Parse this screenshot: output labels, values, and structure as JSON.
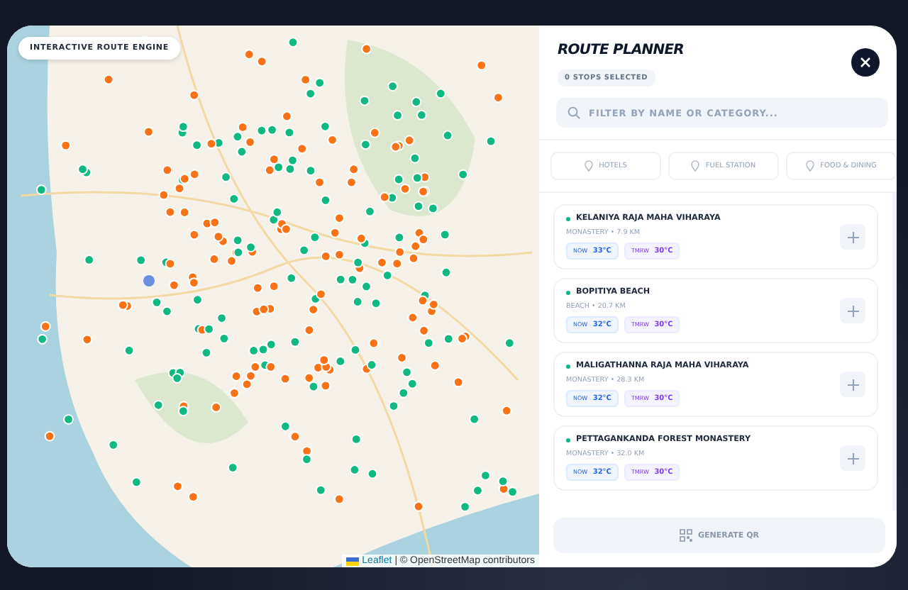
{
  "map": {
    "badge": "INTERACTIVE ROUTE ENGINE",
    "attribution_link": "Leaflet",
    "attribution": "| © OpenStreetMap contributors"
  },
  "panel": {
    "title": "ROUTE PLANNER",
    "selected_count": "0 STOPS SELECTED",
    "search": {
      "placeholder": "FILTER BY NAME OR CATEGORY..."
    },
    "filters": [
      {
        "label": "HOTELS",
        "selected": false
      },
      {
        "label": "FUEL STATION",
        "selected": false
      },
      {
        "label": "FOOD & DINING",
        "selected": false
      }
    ],
    "stops": [
      {
        "name": "KELANIYA RAJA MAHA VIHARAYA",
        "meta": "MONASTERY • 7.9 KM",
        "now_label": "NOW",
        "now": "33°C",
        "tmrw_label": "TMRW",
        "tmrw": "30°C",
        "color": "#10b981",
        "added": false
      },
      {
        "name": "BOPITIYA BEACH",
        "meta": "BEACH • 20.7 KM",
        "now_label": "NOW",
        "now": "32°C",
        "tmrw_label": "TMRW",
        "tmrw": "30°C",
        "color": "#10b981",
        "added": false
      },
      {
        "name": "MALIGATHANNA RAJA MAHA VIHARAYA",
        "meta": "MONASTERY • 28.3 KM",
        "now_label": "NOW",
        "now": "32°C",
        "tmrw_label": "TMRW",
        "tmrw": "30°C",
        "color": "#10b981",
        "added": false
      },
      {
        "name": "PETTAGANKANDA FOREST MONASTERY",
        "meta": "MONASTERY • 32.0 KM",
        "now_label": "NOW",
        "now": "32°C",
        "tmrw_label": "TMRW",
        "tmrw": "30°C",
        "color": "#10b981",
        "added": false
      }
    ],
    "generate_button": {
      "label": "GENERATE QR",
      "disabled": true
    }
  }
}
